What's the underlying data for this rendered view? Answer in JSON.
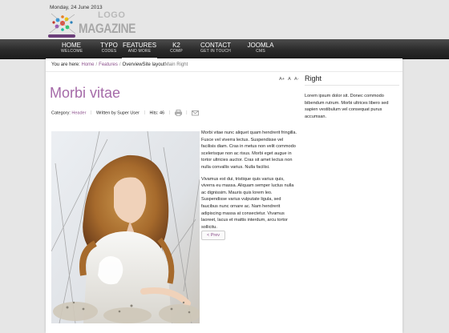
{
  "header": {
    "date": "Monday, 24 June 2013",
    "logo_word1": "LOGO",
    "logo_word2": "MAGAZINE"
  },
  "nav": [
    {
      "title": "HOME",
      "sub": "WELCOME"
    },
    {
      "title": "TYPO",
      "sub": "CODES"
    },
    {
      "title": "FEATURES",
      "sub": "AND MORE",
      "active": true
    },
    {
      "title": "K2",
      "sub": "COMP"
    },
    {
      "title": "CONTACT",
      "sub": "GET IN TOUCH"
    },
    {
      "title": "JOOMLA",
      "sub": "CMS"
    }
  ],
  "breadcrumb": {
    "prefix": "You are here:",
    "items": [
      "Home",
      "Features",
      "OverviewSite layout",
      "Main Right"
    ]
  },
  "fontsize": {
    "increase": "A+",
    "reset": "A",
    "decrease": "A-"
  },
  "article": {
    "title": "Morbi vitae",
    "category_label": "Category:",
    "category": "Header",
    "author": "Written by Super User",
    "hits": "Hits: 46",
    "para1": "Morbi vitae nunc aliquet quam hendrerit fringilla. Fusce vel viverra lectus. Suspendisse vel facilisis diam. Cras in metus non velit commodo scelerisque non ac risus. Morbi eget augue in tortor ultricies auctor. Cras sit amet lectus non nulla convallis varius. Nulla facilisi.",
    "para2": "Vivamus est dui, tristique quis varius quis, viverra eu massa. Aliquam semper luctus nulla ac dignissim. Mauris quis lorem leo. Suspendisse varius vulputate ligula, sed faucibus nunc ornare ac. Nam hendrerit adipiscing massa at consectetur. Vivamus laoreet, lacus et mattis interdum, arcu tortor sollicitu.",
    "prev": "< Prev"
  },
  "right": {
    "title": "Right",
    "text": "Lorem ipsum dolor sit. Donec commodo bibendum rutrum. Morbi ultrices libero sed sapien vestibulum vel consequat purus accumsan."
  },
  "colors": {
    "accent": "#a56aa8",
    "link": "#8b4f8b",
    "nav_bg": "#2b2b2b"
  }
}
